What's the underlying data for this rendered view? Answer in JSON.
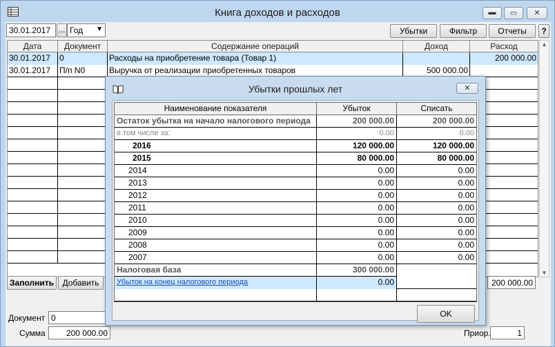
{
  "window": {
    "title": "Книга доходов и расходов"
  },
  "toolbar": {
    "date": "30.01.2017",
    "ellipsis": "...",
    "period": "Год",
    "losses_btn": "Убытки",
    "filter_btn": "Фильтр",
    "reports_btn": "Отчеты",
    "help_btn": "?"
  },
  "grid": {
    "columns": [
      "Дата",
      "Документ",
      "Содержание операций",
      "Доход",
      "Расход"
    ],
    "rows": [
      {
        "date": "30.01.2017",
        "doc": "0",
        "content": "Расходы на приобретение товара  (Товар 1)",
        "income": "",
        "expense": "200 000.00"
      },
      {
        "date": "30.01.2017",
        "doc": "П/п N0",
        "content": "Выручка от реализации приобретенных товаров",
        "income": "500 000.00",
        "expense": ""
      }
    ],
    "total_expense": "200 000.00"
  },
  "bottom": {
    "fill_btn": "Заполнить",
    "add_btn": "Добавить",
    "document_label": "Документ",
    "document_value": "0",
    "sum_label": "Сумма",
    "sum_value": "200 000.00",
    "prior_label": "Приор.",
    "prior_value": "1"
  },
  "dialog": {
    "title": "Убытки прошлых лет",
    "columns": [
      "Наименование показателя",
      "Убыток",
      "Списать"
    ],
    "rows": [
      {
        "name": "Остаток убытка на начало налогового периода",
        "loss": "200 000.00",
        "write": "200 000.00"
      },
      {
        "name": "в том числе за:",
        "loss": "0.00",
        "write": "0.00"
      },
      {
        "name": "2016",
        "loss": "120 000.00",
        "write": "120 000.00"
      },
      {
        "name": "2015",
        "loss": "80 000.00",
        "write": "80 000.00"
      },
      {
        "name": "2014",
        "loss": "0.00",
        "write": "0.00"
      },
      {
        "name": "2013",
        "loss": "0.00",
        "write": "0.00"
      },
      {
        "name": "2012",
        "loss": "0.00",
        "write": "0.00"
      },
      {
        "name": "2011",
        "loss": "0.00",
        "write": "0.00"
      },
      {
        "name": "2010",
        "loss": "0.00",
        "write": "0.00"
      },
      {
        "name": "2009",
        "loss": "0.00",
        "write": "0.00"
      },
      {
        "name": "2008",
        "loss": "0.00",
        "write": "0.00"
      },
      {
        "name": "2007",
        "loss": "0.00",
        "write": "0.00"
      },
      {
        "name": "Налоговая база",
        "loss": "300 000.00",
        "write": ""
      },
      {
        "name": "Убыток на конец налогового периода",
        "loss": "0.00",
        "write": ""
      }
    ],
    "ok_btn": "OK"
  }
}
